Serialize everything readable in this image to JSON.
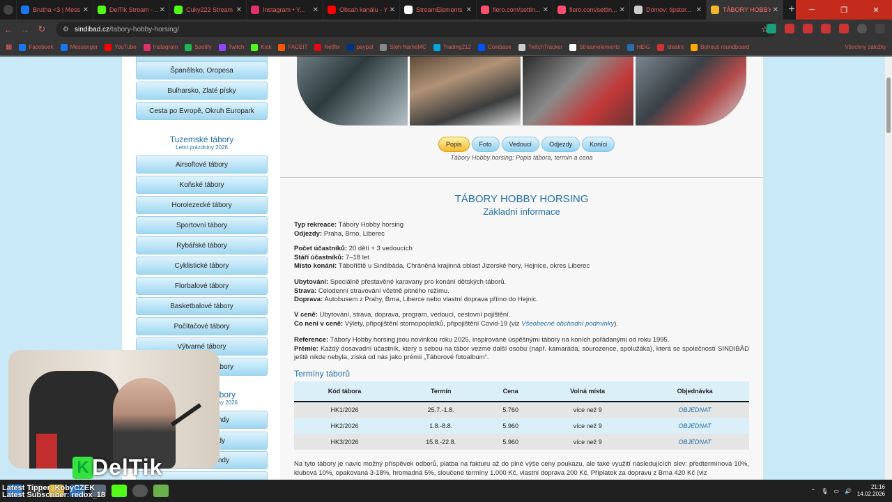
{
  "browser": {
    "tabs": [
      {
        "title": "Brutha <3 | Mess...",
        "icon": "messenger-icon",
        "color": "#1877f2"
      },
      {
        "title": "DelTik Stream - ...",
        "icon": "kick-icon",
        "color": "#53fc18"
      },
      {
        "title": "Cuky222 Stream",
        "icon": "kick-icon",
        "color": "#53fc18"
      },
      {
        "title": "Instagram • Y...",
        "icon": "instagram-icon",
        "color": "#e1306c"
      },
      {
        "title": "Obsah kanálu - Y...",
        "icon": "youtube-icon",
        "color": "#ff0000"
      },
      {
        "title": "StreamElements",
        "icon": "streamelements-icon",
        "color": "#ffffff"
      },
      {
        "title": "fiero.com/settin...",
        "icon": "fiero-icon",
        "color": "#ff4d6d"
      },
      {
        "title": "fiero.com/settin...",
        "icon": "fiero-icon",
        "color": "#ff4d6d"
      },
      {
        "title": "Domov: tipster...",
        "icon": "globe-icon",
        "color": "#cccccc"
      },
      {
        "title": "TÁBORY HOBBY...",
        "icon": "sindibad-icon",
        "color": "#f5b82c"
      }
    ],
    "active_tab_index": 9,
    "url_host": "sindibad.cz",
    "url_path": "/tabory-hobby-horsing/",
    "bookmarks": [
      {
        "label": "Facebook",
        "color": "#1877f2"
      },
      {
        "label": "Messenger",
        "color": "#1877f2"
      },
      {
        "label": "YouTube",
        "color": "#ff0000"
      },
      {
        "label": "Instagram",
        "color": "#e1306c"
      },
      {
        "label": "Spotify",
        "color": "#1db954"
      },
      {
        "label": "Twitch",
        "color": "#9146ff"
      },
      {
        "label": "Kick",
        "color": "#53fc18"
      },
      {
        "label": "FACEIT",
        "color": "#ff5500"
      },
      {
        "label": "Netflix",
        "color": "#e50914"
      },
      {
        "label": "paypal",
        "color": "#003087"
      },
      {
        "label": "Steh NameMC",
        "color": "#888888"
      },
      {
        "label": "Trading212",
        "color": "#00a7e1"
      },
      {
        "label": "Coinbase",
        "color": "#0052ff"
      },
      {
        "label": "TwitchTracker",
        "color": "#cccccc"
      },
      {
        "label": "Streamelements",
        "color": "#ffffff"
      },
      {
        "label": "HEIG",
        "color": "#2b6cb0"
      },
      {
        "label": "Ideální",
        "color": "#cc3333"
      },
      {
        "label": "Bohouš roundboard",
        "color": "#ffaa00"
      }
    ],
    "bookmarks_right": "Všechny záložky"
  },
  "sidebar": {
    "top_items": [
      "Španělsko, Oropesa",
      "Bulharsko, Zlaté písky",
      "Cesta po Evropě, Okruh Europark"
    ],
    "section1_title": "Tuzemské tábory",
    "section1_sub": "Letní prázdniny 2026",
    "section1_items": [
      "Airsoftové tábory",
      "Koňské tábory",
      "Horolezecké tábory",
      "Sportovní tábory",
      "Rybářské tábory",
      "Cyklistické tábory",
      "Florbalové tábory",
      "Basketbalové tábory",
      "Počítačové tábory",
      "Výtvarné tábory",
      "ábory"
    ],
    "section2_title": "bory",
    "section2_sub": "zdniny 2026",
    "section2_items": [
      "endy",
      "dy",
      "kendy",
      ""
    ]
  },
  "content": {
    "tabs": [
      "Popis",
      "Foto",
      "Vedoucí",
      "Odjezdy",
      "Koníci"
    ],
    "selected_tab": "Popis",
    "caption": "Tábory Hobby horsing: Popis tábora, termín a cena",
    "title": "TÁBORY HOBBY HORSING",
    "subtitle": "Základní informace",
    "info": {
      "typ_label": "Typ rekreace:",
      "typ": "Tábory Hobby horsing",
      "odjezdy_label": "Odjezdy:",
      "odjezdy": "Praha, Brno, Liberec",
      "pocet_label": "Počet účastníků:",
      "pocet": "20 dětí + 3 vedoucích",
      "stari_label": "Stáří účastníků:",
      "stari": "7–18 let",
      "misto_label": "Místo konání:",
      "misto": "Tábořiště u Sindibáda, Chráněná krajinná oblast Jizerské hory, Hejnice, okres Liberec",
      "ubytovani_label": "Ubytování:",
      "ubytovani": "Speciálně přestavěné karavany pro konání dětských táborů.",
      "strava_label": "Strava:",
      "strava": "Celodenní stravování včetně pitného režimu.",
      "doprava_label": "Doprava:",
      "doprava": "Autobusem z Prahy, Brna, Liberce nebo vlastní doprava přímo do Hejnic.",
      "vcene_label": "V ceně:",
      "vcene": "Ubytování, strava, doprava, program, vedoucí, cestovní pojištění.",
      "nenivcene_label": "Co není v ceně:",
      "nenivcene": "Výlety, připojištění stornopoplatků, připojištění Covid-19 (viz",
      "nenivcene_link": "Všeobecné obchodní podmínky",
      "nenivcene_end": ").",
      "reference_label": "Reference:",
      "reference": "Tábory Hobby horsing jsou novinkou roku 2025, inspirované úspěšnými tábory na koních pořádanými od roku 1995.",
      "premie_label": "Prémie:",
      "premie": "Každý dosavadní účastník, který s sebou na tábor vezme další osobu (např. kamaráda, sourozence, spolužáka), která se společností SINDIBÁD ještě nikde nebyla, získá od nás jako prémii „Táborové fotoalbum“."
    },
    "terminy_title": "Termíny táborů",
    "table": {
      "headers": [
        "Kód tábora",
        "Termín",
        "Cena",
        "Volná místa",
        "Objednávka"
      ],
      "rows": [
        [
          "HK1/2026",
          "25.7.-1.8.",
          "5.760",
          "více než 9",
          "OBJEDNAT"
        ],
        [
          "HK2/2026",
          "1.8.-8.8.",
          "5.960",
          "více než 9",
          "OBJEDNAT"
        ],
        [
          "HK3/2026",
          "15.8.-22.8.",
          "5.960",
          "více než 9",
          "OBJEDNAT"
        ]
      ]
    },
    "footer_text": "Na tyto tábory je navíc možný příspěvek odborů, platba na fakturu až do plné výše ceny poukazu, ale také využití následujících slev: předtermínová 10%, klubová 10%, opakovaná 3-18%, hromadná 5%, sloučené termíny 1.000 Kč, vlastní doprava 200 Kč. Příplatek za dopravu z Brna 420 Kč (viz"
  },
  "stream_overlay": {
    "logo_text": "DelTik",
    "line1": "Latest Tipper: KobyCZEK",
    "line2": "Latest Subscriber: redox_18"
  },
  "taskbar": {
    "time": "21:16",
    "date": "14.02.2026"
  }
}
